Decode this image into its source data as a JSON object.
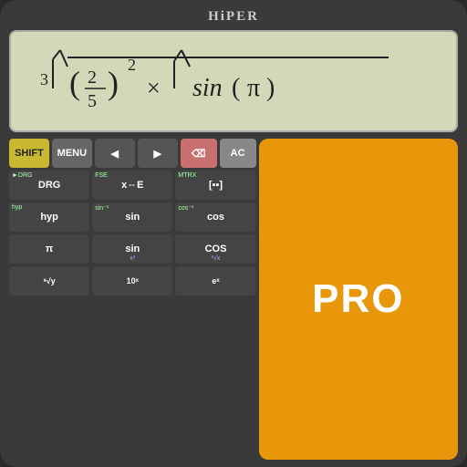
{
  "app": {
    "title": "HiPER",
    "bg_color": "#3a3a3a"
  },
  "display": {
    "formula": "3√((2/5)²) × √sin(π)",
    "bg_color": "#d4d8b8"
  },
  "pro_badge": {
    "text": "PRO",
    "bg_color": "#e8960a"
  },
  "keypad": {
    "row1": [
      {
        "label": "SHIFT",
        "type": "shift"
      },
      {
        "label": "MENU",
        "type": "menu"
      },
      {
        "label": "◀",
        "type": "arrow"
      },
      {
        "label": "▶",
        "type": "arrow"
      },
      {
        "label": "⌫",
        "type": "backspace"
      },
      {
        "label": "AC",
        "type": "ac"
      }
    ],
    "row2_top_labels": [
      "►DRG",
      "FSE",
      "MTRX"
    ],
    "row2": [
      {
        "top": "►DRG",
        "label": "DRG",
        "type": "dark"
      },
      {
        "top": "FSE",
        "label": "x⇔E",
        "type": "dark"
      },
      {
        "top": "MTRX",
        "label": "[ ]",
        "type": "dark"
      }
    ],
    "row3_top_labels": [
      "hyp",
      "sin⁻¹",
      "cos⁻¹"
    ],
    "row3": [
      {
        "top": "hyp",
        "label": "hyp",
        "type": "dark"
      },
      {
        "top": "sin⁻¹",
        "label": "sin",
        "type": "dark"
      },
      {
        "top": "cos⁻¹",
        "label": "cos",
        "type": "dark"
      }
    ],
    "row4_sub_labels": [
      "",
      "x³",
      "³√x"
    ],
    "row4": [
      {
        "label": "π",
        "sub": "",
        "type": "dark"
      },
      {
        "label": "sin",
        "sub": "x³",
        "type": "dark"
      },
      {
        "label": "cos",
        "sub": "³√x",
        "type": "dark"
      }
    ],
    "row5_sub_labels": [
      "",
      "",
      "ˣ√y",
      "10ˣ",
      "eˣ"
    ],
    "row5": [
      {
        "label": "ˣ√y",
        "type": "dark"
      },
      {
        "label": "10ˣ",
        "type": "dark"
      },
      {
        "label": "eˣ",
        "type": "dark"
      }
    ]
  }
}
